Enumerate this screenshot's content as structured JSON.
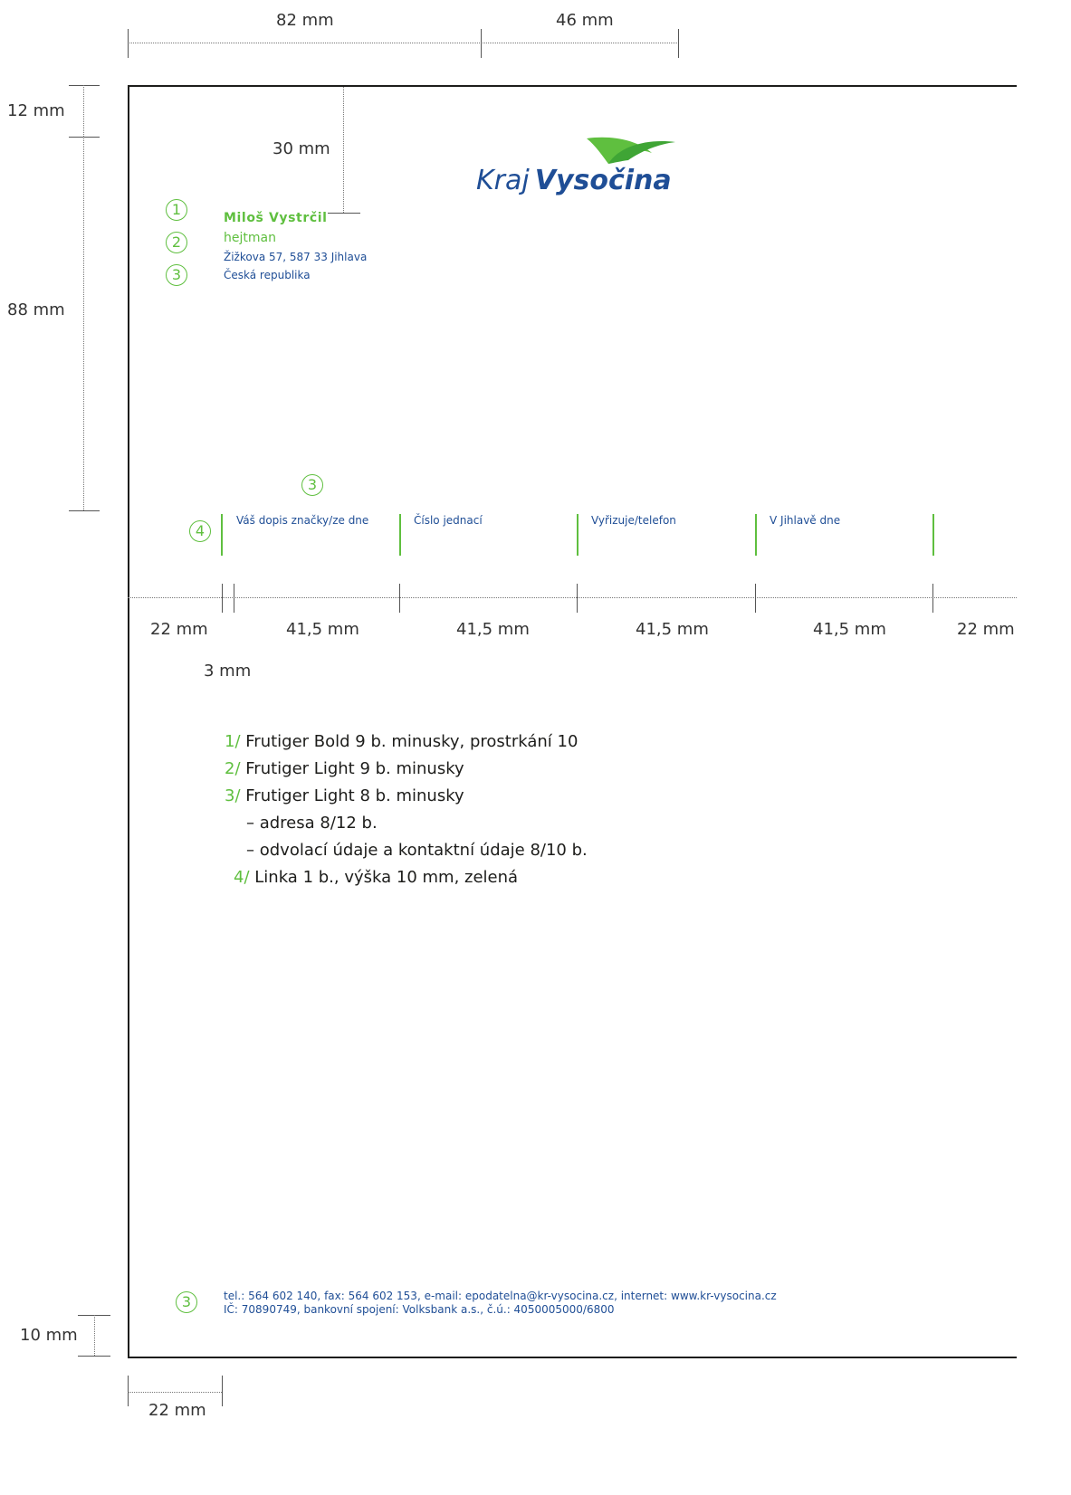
{
  "dimensions": {
    "top_left": "82 mm",
    "top_right": "46 mm",
    "left_top": "12 mm",
    "logo_offset": "30 mm",
    "left_main": "88 mm",
    "bottom_margin": "10 mm",
    "bottom_left": "22 mm",
    "row": [
      "22 mm",
      "41,5 mm",
      "41,5 mm",
      "41,5 mm",
      "41,5 mm",
      "22 mm"
    ],
    "gap": "3 mm"
  },
  "logo": {
    "text_light": "Kraj",
    "text_bold": "Vysočina"
  },
  "markers": {
    "m1": "1",
    "m2": "2",
    "m3": "3",
    "m4": "4"
  },
  "address": {
    "name": "Miloš Vystrčil",
    "title": "hejtman",
    "street": "Žižkova 57, 587 33 Jihlava",
    "country": "Česká republika"
  },
  "reference_fields": [
    "Váš dopis značky/ze dne",
    "Číslo jednací",
    "Vyřizuje/telefon",
    "V Jihlavě dne"
  ],
  "notes": [
    {
      "num": "1/",
      "text": "Frutiger Bold 9 b. minusky, prostrkání 10"
    },
    {
      "num": "2/",
      "text": "Frutiger Light 9 b. minusky"
    },
    {
      "num": "3/",
      "text": "Frutiger Light 8 b. minusky"
    },
    {
      "num": "",
      "text": "– adresa 8/12 b."
    },
    {
      "num": "",
      "text": "– odvolací údaje a kontaktní údaje 8/10 b."
    },
    {
      "num": "4/",
      "text": "Linka 1 b., výška 10 mm, zelená"
    }
  ],
  "footer": {
    "line1": "tel.: 564 602 140, fax: 564 602 153, e-mail: epodatelna@kr-vysocina.cz, internet: www.kr-vysocina.cz",
    "line2": "IČ: 70890749, bankovní spojení: Volksbank a.s., č.ú.: 4050005000/6800"
  },
  "colors": {
    "green": "#5fbf3f",
    "blue": "#1f4e96"
  }
}
